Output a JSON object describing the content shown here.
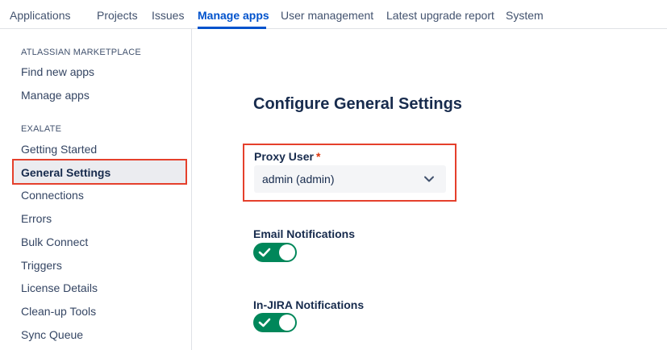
{
  "topnav": {
    "tabs": [
      {
        "label": "Applications"
      },
      {
        "label": "Projects"
      },
      {
        "label": "Issues"
      },
      {
        "label": "Manage apps",
        "active": true
      },
      {
        "label": "User management"
      },
      {
        "label": "Latest upgrade report"
      },
      {
        "label": "System"
      }
    ]
  },
  "sidebar": {
    "marketplace_heading": "ATLASSIAN MARKETPLACE",
    "marketplace_items": [
      {
        "label": "Find new apps"
      },
      {
        "label": "Manage apps"
      }
    ],
    "exalate_heading": "EXALATE",
    "exalate_items": [
      {
        "label": "Getting Started"
      },
      {
        "label": "General Settings",
        "selected": true
      },
      {
        "label": "Connections"
      },
      {
        "label": "Errors"
      },
      {
        "label": "Bulk Connect"
      },
      {
        "label": "Triggers"
      },
      {
        "label": "License Details"
      },
      {
        "label": "Clean-up Tools"
      },
      {
        "label": "Sync Queue"
      }
    ]
  },
  "main": {
    "title": "Configure General Settings",
    "proxy_user": {
      "label": "Proxy User",
      "required_mark": "*",
      "selected_value": "admin (admin)"
    },
    "email_notifications": {
      "label": "Email Notifications",
      "enabled": true
    },
    "injira_notifications": {
      "label": "In-JIRA Notifications",
      "enabled": true
    }
  },
  "colors": {
    "accent": "#0052cc",
    "highlight_border": "#e5402c",
    "toggle_on": "#00875a",
    "required": "#de350b"
  },
  "icons": {
    "select_chevron": "chevron-down-icon",
    "toggle_check": "check-icon"
  }
}
